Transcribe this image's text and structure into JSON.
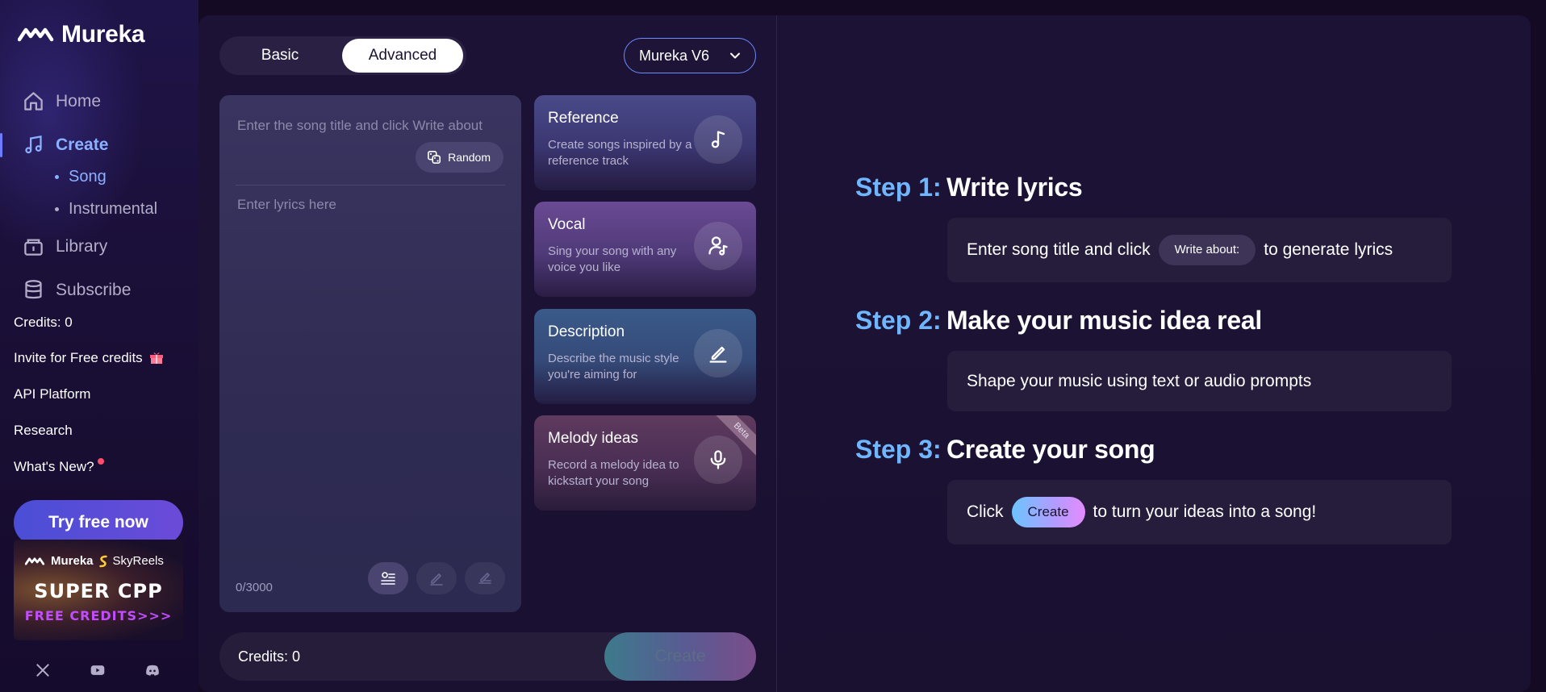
{
  "brand": {
    "name": "Mureka"
  },
  "sidebar": {
    "nav": [
      {
        "label": "Home",
        "icon": "home-icon"
      },
      {
        "label": "Create",
        "icon": "music-note-icon"
      },
      {
        "label": "Library",
        "icon": "library-icon"
      },
      {
        "label": "Subscribe",
        "icon": "database-icon"
      }
    ],
    "sub": [
      {
        "label": "Song"
      },
      {
        "label": "Instrumental"
      }
    ],
    "credits": "Credits: 0",
    "links": [
      "Invite for Free credits",
      "API Platform",
      "Research",
      "What's New?"
    ],
    "try_button": "Try free now",
    "promo": {
      "brand1": "Mureka",
      "brand2": "SkyReels",
      "headline": "SUPER CPP",
      "sub": "FREE CREDITS>>>"
    },
    "social": [
      "x-icon",
      "youtube-icon",
      "discord-icon"
    ]
  },
  "composer": {
    "modes": [
      "Basic",
      "Advanced"
    ],
    "active_mode": "Advanced",
    "model": "Mureka V6",
    "title_placeholder": "Enter the song title and click Write about",
    "random_label": "Random",
    "lyrics_placeholder": "Enter lyrics here",
    "counter": "0/3000",
    "cards": [
      {
        "title": "Reference",
        "sub": "Create songs inspired by a reference track",
        "icon": "music-note-icon"
      },
      {
        "title": "Vocal",
        "sub": "Sing your song with any voice you like",
        "icon": "voice-user-icon"
      },
      {
        "title": "Description",
        "sub": "Describe the music style you're aiming for",
        "icon": "pen-icon"
      },
      {
        "title": "Melody ideas",
        "sub": "Record a melody idea to kickstart your song",
        "icon": "microphone-icon",
        "badge": "Beta"
      }
    ],
    "credits": "Credits: 0",
    "create_label": "Create"
  },
  "steps": [
    {
      "label": "Step 1:",
      "title": "Write lyrics",
      "pre": "Enter song title and click",
      "pill": "Write about:",
      "post": "to generate lyrics"
    },
    {
      "label": "Step 2:",
      "title": "Make your music idea real",
      "text": "Shape your music using text or audio prompts"
    },
    {
      "label": "Step 3:",
      "title": "Create your song",
      "pre": "Click",
      "pill": "Create",
      "post": "to turn your ideas into a song!"
    }
  ],
  "colors": {
    "accent": "#8ab0ff",
    "step": "#6fb6ff",
    "background": "#140a24"
  }
}
